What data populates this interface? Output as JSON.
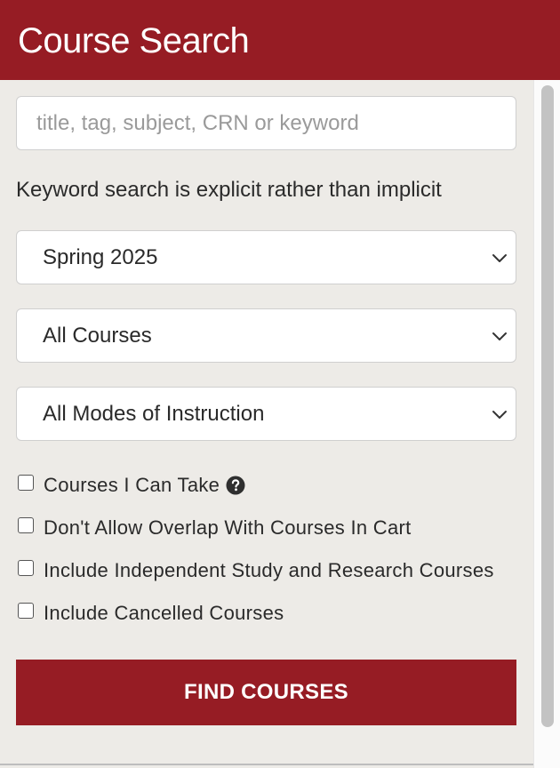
{
  "header": {
    "title": "Course Search",
    "color": "#961c24"
  },
  "search": {
    "placeholder": "title, tag, subject, CRN or keyword",
    "value": "",
    "note": "Keyword search is explicit rather than implicit"
  },
  "filters": {
    "term": {
      "selected": "Spring 2025"
    },
    "courses": {
      "selected": "All Courses"
    },
    "instruction_mode": {
      "selected": "All Modes of Instruction"
    }
  },
  "options": [
    {
      "label": "Courses I Can Take",
      "checked": false,
      "help_icon": "question-circle-icon"
    },
    {
      "label": "Don't Allow Overlap With Courses In Cart",
      "checked": false
    },
    {
      "label": "Include Independent Study and Research Courses",
      "checked": false
    },
    {
      "label": "Include Cancelled Courses",
      "checked": false
    }
  ],
  "actions": {
    "find_label": "FIND COURSES"
  }
}
